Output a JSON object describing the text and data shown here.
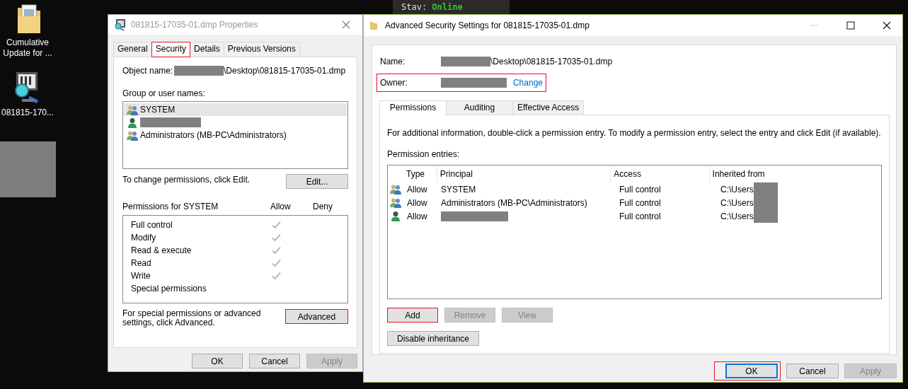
{
  "desktop": {
    "icons": [
      {
        "label": "Cumulative Update for ...",
        "kind": "folder"
      },
      {
        "label": "081815-170...",
        "kind": "dump"
      }
    ],
    "chat": {
      "status_label": "Stav:",
      "status_value": "Online"
    }
  },
  "properties_window": {
    "title": "081815-17035-01.dmp Properties",
    "tabs": [
      {
        "label": "General",
        "selected": false,
        "highlighted": false
      },
      {
        "label": "Security",
        "selected": true,
        "highlighted": true
      },
      {
        "label": "Details",
        "selected": false,
        "highlighted": false
      },
      {
        "label": "Previous Versions",
        "selected": false,
        "highlighted": false
      }
    ],
    "object_name": {
      "label": "Object name:",
      "value": "\\Desktop\\081815-17035-01.dmp",
      "redacted": true
    },
    "groups_label": "Group or user names:",
    "groups": [
      {
        "name": "SYSTEM",
        "kind": "group",
        "selected": true,
        "redacted": false
      },
      {
        "kind": "user",
        "selected": false,
        "redacted": true
      },
      {
        "name": "Administrators (MB-PC\\Administrators)",
        "kind": "group",
        "selected": false,
        "redacted": false
      }
    ],
    "edit_hint": "To change permissions, click Edit.",
    "edit_button": "Edit...",
    "permissions_label": "Permissions for SYSTEM",
    "permission_columns": [
      "Allow",
      "Deny"
    ],
    "permissions": [
      {
        "name": "Full control",
        "allow": true,
        "deny": false
      },
      {
        "name": "Modify",
        "allow": true,
        "deny": false
      },
      {
        "name": "Read & execute",
        "allow": true,
        "deny": false
      },
      {
        "name": "Read",
        "allow": true,
        "deny": false
      },
      {
        "name": "Write",
        "allow": true,
        "deny": false
      },
      {
        "name": "Special permissions",
        "allow": false,
        "deny": false
      }
    ],
    "advanced_hint": "For special permissions or advanced settings, click Advanced.",
    "advanced_button": {
      "label": "Advanced",
      "highlighted": true
    },
    "buttons": [
      {
        "label": "OK",
        "disabled": false
      },
      {
        "label": "Cancel",
        "disabled": false
      },
      {
        "label": "Apply",
        "disabled": true
      }
    ]
  },
  "advanced_window": {
    "title": "Advanced Security Settings for 081815-17035-01.dmp",
    "name": {
      "label": "Name:",
      "value": "\\Desktop\\081815-17035-01.dmp",
      "redacted": true
    },
    "owner": {
      "label": "Owner:",
      "link": "Change",
      "redacted": true,
      "highlighted": true
    },
    "tabs": [
      {
        "label": "Permissions",
        "selected": true
      },
      {
        "label": "Auditing",
        "selected": false
      },
      {
        "label": "Effective Access",
        "selected": false
      }
    ],
    "info": "For additional information, double-click a permission entry. To modify a permission entry, select the entry and click Edit (if available).",
    "entries_label": "Permission entries:",
    "columns": [
      "Type",
      "Principal",
      "Access",
      "Inherited from"
    ],
    "entries": [
      {
        "kind": "group",
        "type": "Allow",
        "principal": "SYSTEM",
        "access": "Full control",
        "inherited_from": "C:\\Users",
        "redacted": false
      },
      {
        "kind": "group",
        "type": "Allow",
        "principal": "Administrators (MB-PC\\Administrators)",
        "access": "Full control",
        "inherited_from": "C:\\Users",
        "redacted": false
      },
      {
        "kind": "user",
        "type": "Allow",
        "access": "Full control",
        "inherited_from": "C:\\Users",
        "redacted": true
      }
    ],
    "entry_buttons": [
      {
        "label": "Add",
        "disabled": false,
        "highlighted": true
      },
      {
        "label": "Remove",
        "disabled": true,
        "highlighted": false
      },
      {
        "label": "View",
        "disabled": true,
        "highlighted": false
      }
    ],
    "inheritance_button": "Disable inheritance",
    "buttons": [
      {
        "label": "OK",
        "disabled": false,
        "default": true,
        "highlighted": true
      },
      {
        "label": "Cancel",
        "disabled": false,
        "default": false,
        "highlighted": false
      },
      {
        "label": "Apply",
        "disabled": true,
        "default": false,
        "highlighted": false
      }
    ]
  }
}
